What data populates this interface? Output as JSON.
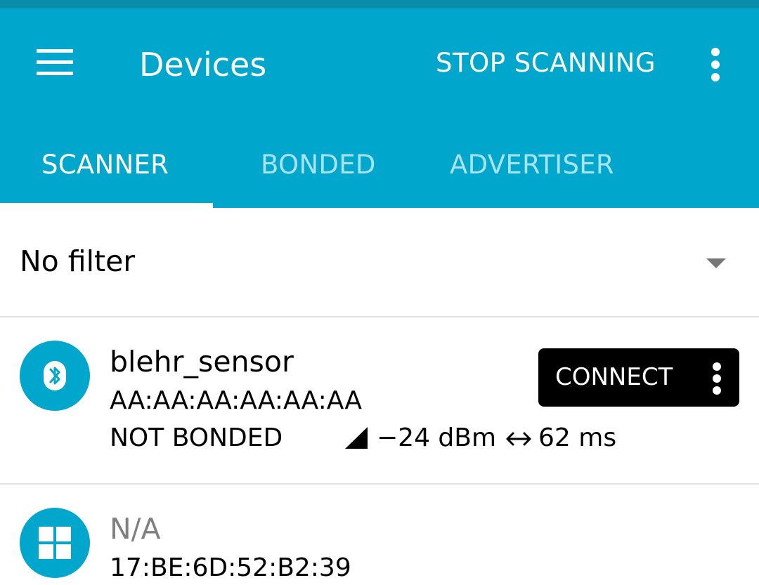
{
  "colors": {
    "primary": "#00a6cc",
    "status_bar": "#0a8cab",
    "accent_inactive_tab": "#a8e3f2",
    "connect_bg": "#000000"
  },
  "toolbar": {
    "menu_icon": "menu-icon",
    "title": "Devices",
    "stop_label": "STOP SCANNING",
    "overflow_icon": "more-vert-icon"
  },
  "tabs": [
    {
      "label": "SCANNER",
      "active": true
    },
    {
      "label": "BONDED",
      "active": false
    },
    {
      "label": "ADVERTISER",
      "active": false
    }
  ],
  "filter": {
    "selected": "No filter",
    "icon": "dropdown-arrow-icon"
  },
  "devices": [
    {
      "icon": "bluetooth-icon",
      "name": "blehr_sensor",
      "address": "AA:AA:AA:AA:AA:AA",
      "bond_state": "NOT BONDED",
      "rssi": "−24 dBm",
      "interval": "62 ms",
      "action_label": "CONNECT"
    },
    {
      "icon": "windows-icon",
      "name": "N/A",
      "address": "17:BE:6D:52:B2:39"
    }
  ]
}
